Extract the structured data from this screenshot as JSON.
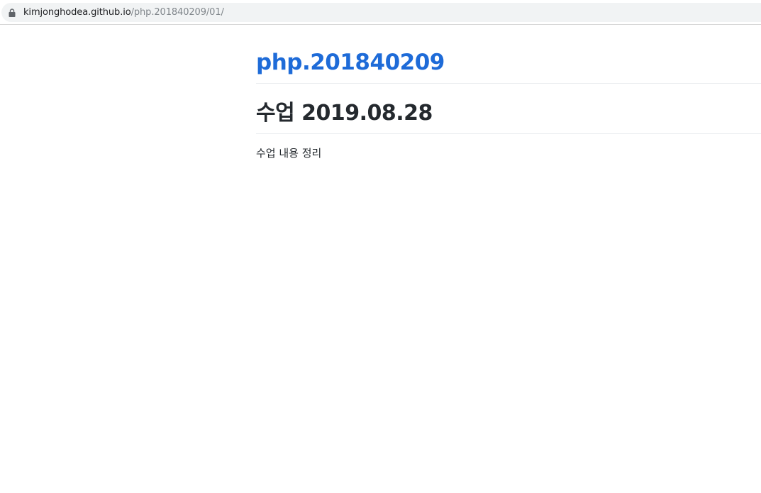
{
  "browser": {
    "url_host": "kimjonghodea.github.io",
    "url_path": "/php.201840209/01/"
  },
  "page": {
    "site_title": "php.201840209",
    "post_title": "수업 2019.08.28",
    "post_body": "수업 내용 정리"
  },
  "colors": {
    "link": "#1e6bd8",
    "text": "#24292e",
    "rule": "#eaecef",
    "omnibox_bg": "#f1f3f4"
  },
  "icons": {
    "address_bar": "lock-icon"
  }
}
